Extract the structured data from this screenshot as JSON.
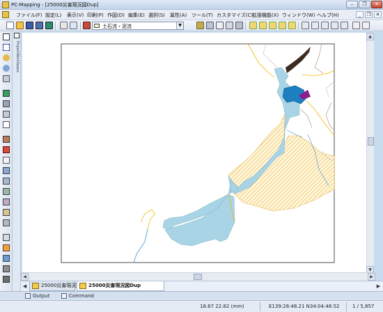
{
  "window": {
    "title": "PC-Mapping - [25000災害現況図Dup]",
    "minimize_label": "–",
    "restore_label": "❐",
    "close_label": "✕"
  },
  "menu": {
    "items": [
      "ファイル(F)",
      "設定(L)",
      "表示(V)",
      "印刷(P)",
      "作図(D)",
      "編集(E)",
      "選択(S)",
      "属性(A)",
      "ツール(T)",
      "カスタマイズ(C)",
      "拡張機能(X)",
      "ウィンドウ(W)",
      "ヘルプ(H)"
    ],
    "mdi_buttons": [
      "_",
      "❐",
      "✕"
    ]
  },
  "toolbar": {
    "layer_select_value": "土石流・泥流",
    "layer_dropdown_arrow": "▼"
  },
  "left_panel": {
    "tab_label": "ProjectWorkSpace"
  },
  "map": {
    "colors": {
      "land_blue": "#a9d4e6",
      "dark_blue": "#1b7fc0",
      "purple": "#8a1e8a",
      "hatch_yellow": "#f2d88a",
      "road_orange": "#f0b800",
      "river_blue": "#3a8fd0",
      "contour_brown": "#a08a6a",
      "black_road": "#3d2b1f"
    }
  },
  "scroll": {
    "up": "▲",
    "down": "▼",
    "left": "◀",
    "right": "▶"
  },
  "doc_tabs": {
    "nav_left": "◀",
    "nav_right": "▶",
    "tabs": [
      {
        "label": "25000災害現況図",
        "active": false
      },
      {
        "label": "25000災害現況図Dup",
        "active": true
      }
    ]
  },
  "output_tabs": [
    {
      "label": "Output"
    },
    {
      "label": "Command"
    }
  ],
  "status": {
    "scale_coords": "18.67 22.82 (mm)",
    "latlon": "E139:28:48.21 N34:04:48.52",
    "zoom": "1 / 5,857"
  }
}
